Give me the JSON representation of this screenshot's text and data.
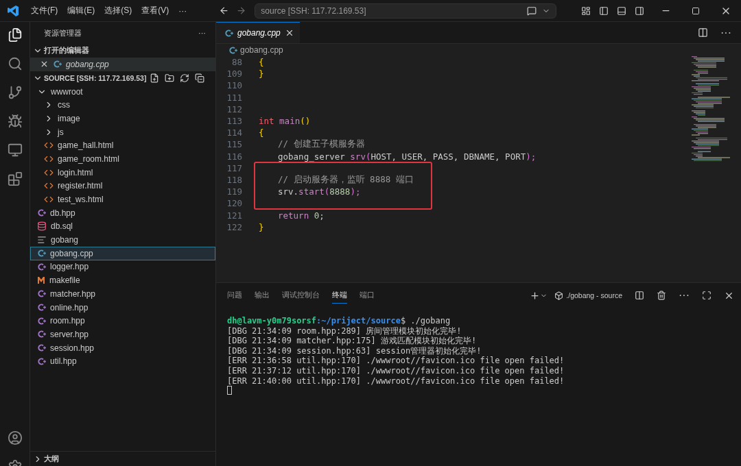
{
  "menu": [
    "文件(F)",
    "编辑(E)",
    "选择(S)",
    "查看(V)",
    "···"
  ],
  "command_center": {
    "text": "source [SSH: 117.72.169.53]"
  },
  "sidebar": {
    "title": "资源管理器",
    "more": "···",
    "open_editors": {
      "label": "打开的编辑器",
      "expanded": true,
      "items": [
        {
          "name": "gobang.cpp",
          "kind": "cpp"
        }
      ]
    },
    "folder": {
      "label": "SOURCE [SSH: 117.72.169.53]",
      "expanded": true,
      "items": [
        {
          "name": "wwwroot",
          "kind": "folder",
          "expanded": true,
          "selected": false,
          "children": [
            {
              "name": "css",
              "kind": "folder",
              "expanded": false,
              "selected": false
            },
            {
              "name": "image",
              "kind": "folder",
              "expanded": false,
              "selected": false
            },
            {
              "name": "js",
              "kind": "folder",
              "expanded": false,
              "selected": false
            },
            {
              "name": "game_hall.html",
              "kind": "html",
              "selected": false
            },
            {
              "name": "game_room.html",
              "kind": "html",
              "selected": false
            },
            {
              "name": "login.html",
              "kind": "html",
              "selected": false
            },
            {
              "name": "register.html",
              "kind": "html",
              "selected": false
            },
            {
              "name": "test_ws.html",
              "kind": "html",
              "selected": false
            }
          ]
        },
        {
          "name": "db.hpp",
          "kind": "hpp",
          "selected": false
        },
        {
          "name": "db.sql",
          "kind": "sql",
          "selected": false
        },
        {
          "name": "gobang",
          "kind": "text",
          "selected": false
        },
        {
          "name": "gobang.cpp",
          "kind": "cpp",
          "selected": true
        },
        {
          "name": "logger.hpp",
          "kind": "hpp",
          "selected": false
        },
        {
          "name": "makefile",
          "kind": "make",
          "selected": false
        },
        {
          "name": "matcher.hpp",
          "kind": "hpp",
          "selected": false
        },
        {
          "name": "online.hpp",
          "kind": "hpp",
          "selected": false
        },
        {
          "name": "room.hpp",
          "kind": "hpp",
          "selected": false
        },
        {
          "name": "server.hpp",
          "kind": "hpp",
          "selected": false
        },
        {
          "name": "session.hpp",
          "kind": "hpp",
          "selected": false
        },
        {
          "name": "util.hpp",
          "kind": "hpp",
          "selected": false
        }
      ]
    },
    "outline": {
      "label": "大纲",
      "expanded": false
    }
  },
  "editor": {
    "tabs": [
      {
        "name": "gobang.cpp",
        "selected": true
      }
    ],
    "breadcrumb": "gobang.cpp",
    "lines": [
      {
        "framed": false,
        "lines": [
          {
            "n": "88",
            "kind": "top",
            "tokens": [
              {
                "text": "{",
                "kind": "bracket"
              }
            ]
          },
          {
            "n": "109",
            "kind": "top",
            "tokens": [
              {
                "text": "}",
                "kind": "bracket"
              }
            ]
          },
          {
            "n": "110",
            "kind": "blank"
          },
          {
            "n": "111",
            "kind": "blank"
          },
          {
            "n": "112",
            "kind": "blank"
          },
          {
            "n": "113",
            "kind": "top",
            "tokens": [
              {
                "text": "int",
                "kind": "type"
              },
              {
                "text": "main",
                "kind": "function"
              },
              {
                "text": "()",
                "kind": "bracket"
              }
            ]
          },
          {
            "n": "114",
            "kind": "top",
            "tokens": [
              {
                "text": "{",
                "kind": "bracket"
              }
            ]
          },
          {
            "n": "115",
            "kind": "body",
            "tokens": [
              {
                "text": "// 创建五子棋服务器",
                "kind": "comment"
              }
            ]
          },
          {
            "n": "116",
            "kind": "body",
            "tokens": [
              {
                "text": "gobang_server",
                "kind": "variable"
              },
              {
                "text": "srv",
                "kind": "call"
              },
              {
                "text": "(",
                "kind": "paren"
              },
              {
                "text": "HOST, USER, PASS, DBNAME, PORT",
                "kind": "text"
              },
              {
                "text": ");",
                "kind": "paren"
              }
            ]
          }
        ]
      },
      {
        "framed": true,
        "lines": [
          {
            "n": "117",
            "kind": "blank"
          },
          {
            "n": "118",
            "kind": "body",
            "tokens": [
              {
                "text": "// 启动服务器，监听 8888 端口",
                "kind": "comment"
              }
            ]
          },
          {
            "n": "119",
            "kind": "body",
            "tokens": [
              {
                "text": "srv.",
                "kind": "text"
              },
              {
                "text": "start",
                "kind": "call"
              },
              {
                "text": "(",
                "kind": "paren"
              },
              {
                "text": "8888",
                "kind": "number"
              },
              {
                "text": ");",
                "kind": "paren"
              }
            ]
          },
          {
            "n": "120",
            "kind": "blank"
          }
        ]
      },
      {
        "framed": false,
        "lines": [
          {
            "n": "121",
            "kind": "body",
            "tokens": [
              {
                "text": "return",
                "kind": "control"
              },
              {
                "text": "0",
                "kind": "number"
              },
              {
                "text": ";",
                "kind": "text"
              }
            ]
          },
          {
            "n": "122",
            "kind": "top",
            "tokens": [
              {
                "text": "}",
                "kind": "bracket"
              }
            ]
          }
        ]
      }
    ],
    "more": "···"
  },
  "panel": {
    "tabs": [
      {
        "label": "问题",
        "selected": false
      },
      {
        "label": "输出",
        "selected": false
      },
      {
        "label": "调试控制台",
        "selected": false
      },
      {
        "label": "终端",
        "selected": true
      },
      {
        "label": "端口",
        "selected": false
      }
    ],
    "terminal_name": "./gobang - source",
    "more": "···",
    "prompt": {
      "user": "dh@lavm-y0m79sorsf",
      "path": ":~/priject/source",
      "command": "$ ./gobang"
    },
    "output": [
      "[DBG 21:34:09 room.hpp:289] 房间管理模块初始化完毕!",
      "[DBG 21:34:09 matcher.hpp:175] 游戏匹配模块初始化完毕!",
      "[DBG 21:34:09 session.hpp:63] session管理器初始化完毕!",
      "[ERR 21:36:58 util.hpp:170] ./wwwroot//favicon.ico file open failed!",
      "[ERR 21:37:12 util.hpp:170] ./wwwroot//favicon.ico file open failed!",
      "[ERR 21:40:00 util.hpp:170] ./wwwroot//favicon.ico file open failed!"
    ]
  }
}
